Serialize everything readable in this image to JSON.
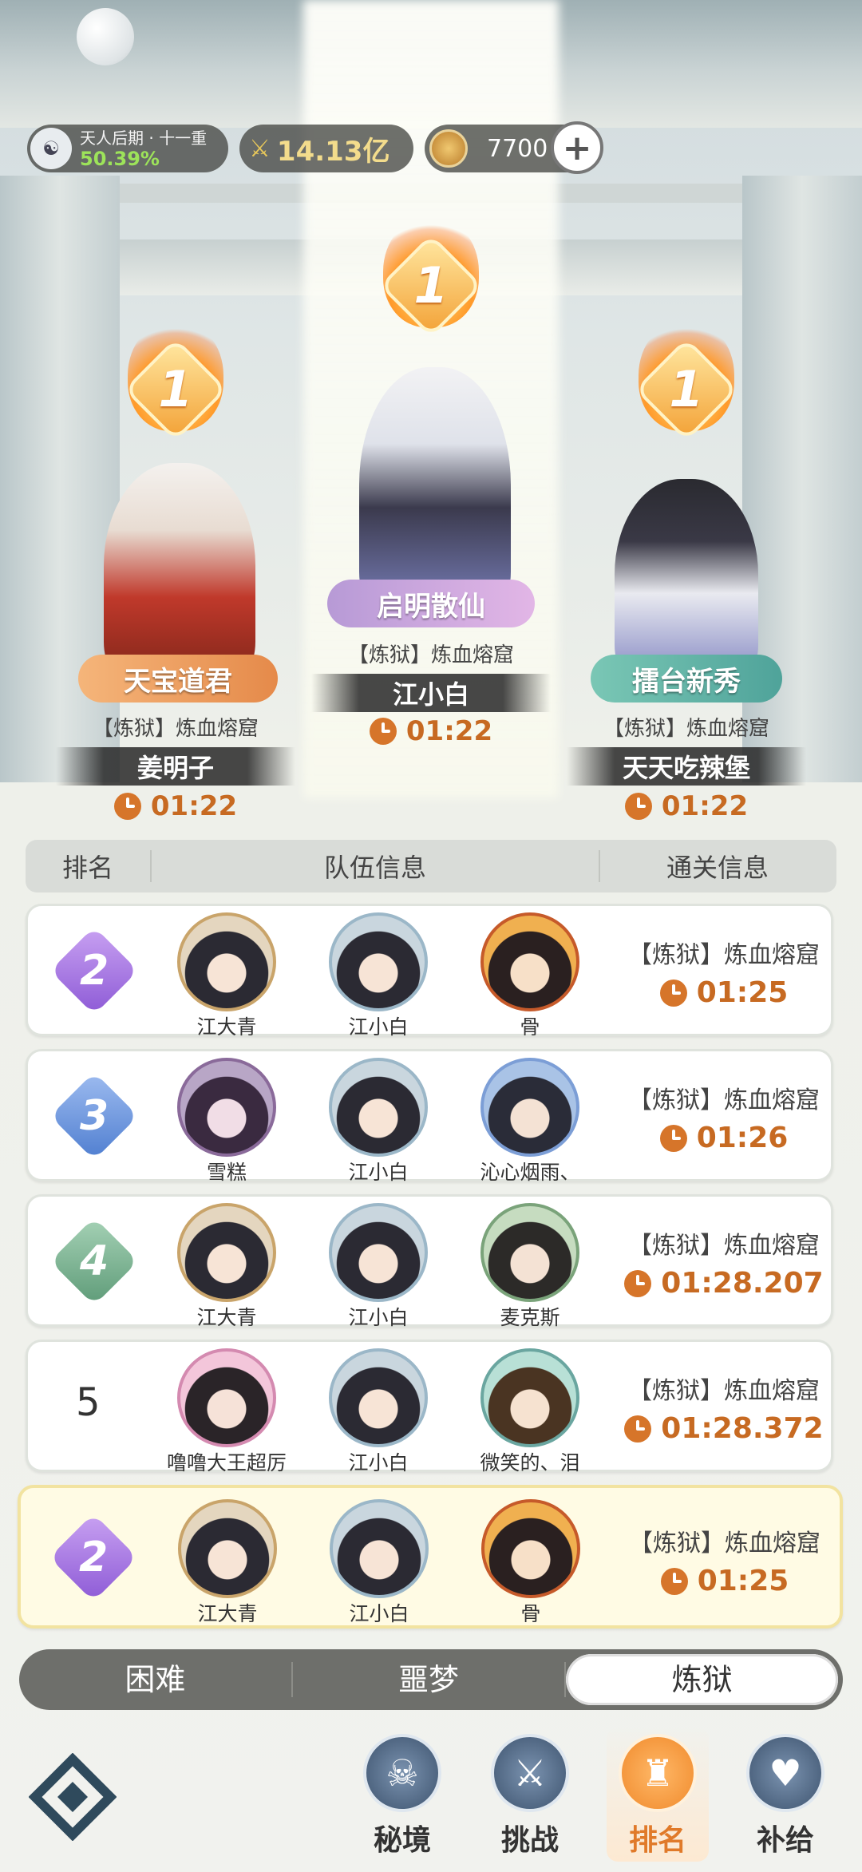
{
  "status_bar": {
    "cultivation": {
      "realm": "天人后期 · 十一重",
      "percent": "50.39%"
    },
    "combat_power": "14.13亿",
    "currency": "7700",
    "add_symbol": "+"
  },
  "podium": [
    {
      "rank_badge": "1",
      "title": "天宝道君",
      "stage": "【炼狱】炼血熔窟",
      "player": "姜明子",
      "time": "01:22"
    },
    {
      "rank_badge": "1",
      "title": "启明散仙",
      "stage": "【炼狱】炼血熔窟",
      "player": "江小白",
      "time": "01:22"
    },
    {
      "rank_badge": "1",
      "title": "擂台新秀",
      "stage": "【炼狱】炼血熔窟",
      "player": "天天吃辣堡",
      "time": "01:22"
    }
  ],
  "table": {
    "headers": {
      "rank": "排名",
      "team": "队伍信息",
      "clear": "通关信息"
    },
    "rows": [
      {
        "rank": "2",
        "members": [
          "江大青",
          "江小白",
          "骨"
        ],
        "stage": "【炼狱】炼血熔窟",
        "time": "01:25"
      },
      {
        "rank": "3",
        "members": [
          "雪糕",
          "江小白",
          "沁心烟雨、"
        ],
        "stage": "【炼狱】炼血熔窟",
        "time": "01:26"
      },
      {
        "rank": "4",
        "members": [
          "江大青",
          "江小白",
          "麦克斯"
        ],
        "stage": "【炼狱】炼血熔窟",
        "time": "01:28.207"
      },
      {
        "rank": "5",
        "members": [
          "噜噜大王超厉",
          "江小白",
          "微笑的、泪"
        ],
        "stage": "【炼狱】炼血熔窟",
        "time": "01:28.372"
      }
    ],
    "my_row": {
      "rank": "2",
      "members": [
        "江大青",
        "江小白",
        "骨"
      ],
      "stage": "【炼狱】炼血熔窟",
      "time": "01:25"
    }
  },
  "difficulty_tabs": [
    {
      "label": "困难",
      "active": false
    },
    {
      "label": "噩梦",
      "active": false
    },
    {
      "label": "炼狱",
      "active": true
    }
  ],
  "bottom_nav": [
    {
      "label": "秘境",
      "icon": "demon-mask-icon"
    },
    {
      "label": "挑战",
      "icon": "crossed-swords-icon"
    },
    {
      "label": "排名",
      "icon": "podium-icon"
    },
    {
      "label": "补给",
      "icon": "supply-heart-icon"
    }
  ],
  "colors": {
    "time_orange": "#c76a22",
    "rank2": "#a070d8",
    "rank3": "#5b86d6",
    "rank4": "#6ca886",
    "active_nav": "#e07a2a"
  }
}
